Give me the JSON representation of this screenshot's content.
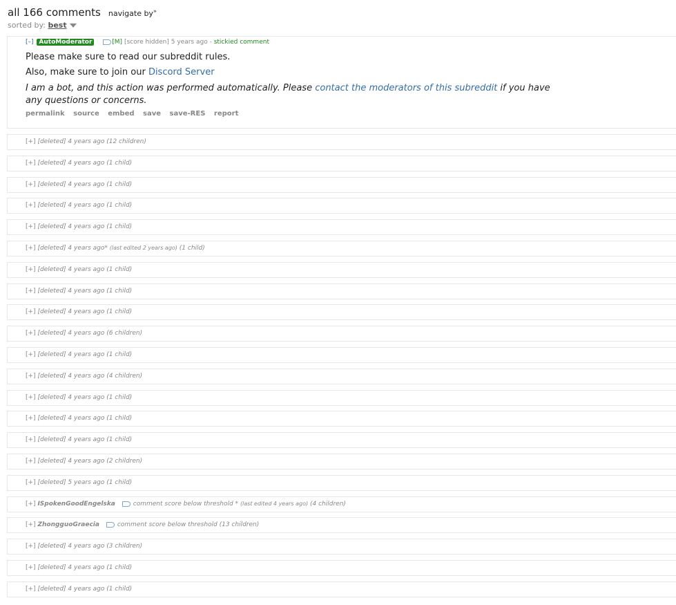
{
  "header": {
    "title": "all 166 comments",
    "navigate": "navigate by",
    "nav_arrow": "»",
    "sorted_label": "sorted by:",
    "sort_value": "best"
  },
  "sticky": {
    "expand": "[–]",
    "author": "AutoModerator",
    "mod_tag": "[M]",
    "score": "[score hidden]",
    "time": "5 years ago",
    "sep": "-",
    "stickied": "stickied comment",
    "line1": "Please make sure to read our subreddit rules.",
    "line2_prefix": "Also, make sure to join our ",
    "line2_link": "Discord Server",
    "line3_prefix": "I am a bot, and this action was performed automatically. Please ",
    "line3_link": "contact the moderators of this subreddit",
    "line3_suffix": " if you have any questions or concerns.",
    "buttons": [
      "permalink",
      "source",
      "embed",
      "save",
      "save-RES",
      "report"
    ]
  },
  "rows": [
    {
      "text": "[deleted] 4 years ago (12 children)"
    },
    {
      "text": "[deleted] 4 years ago (1 child)"
    },
    {
      "text": "[deleted] 4 years ago (1 child)"
    },
    {
      "text": "[deleted] 4 years ago (1 child)"
    },
    {
      "text": "[deleted] 4 years ago (1 child)"
    },
    {
      "text": "[deleted] 4 years ago*",
      "edit": "(last edited 2 years ago)",
      "tail": "(1 child)"
    },
    {
      "text": "[deleted] 4 years ago (1 child)"
    },
    {
      "text": "[deleted] 4 years ago (1 child)"
    },
    {
      "text": "[deleted] 4 years ago (1 child)"
    },
    {
      "text": "[deleted] 4 years ago (6 children)"
    },
    {
      "text": "[deleted] 4 years ago (1 child)"
    },
    {
      "text": "[deleted] 4 years ago (4 children)"
    },
    {
      "text": "[deleted] 4 years ago (1 child)"
    },
    {
      "text": "[deleted] 4 years ago (1 child)"
    },
    {
      "text": "[deleted] 4 years ago (1 child)"
    },
    {
      "text": "[deleted] 4 years ago (2 children)"
    },
    {
      "text": "[deleted] 5 years ago (1 child)"
    },
    {
      "author": "ISpokenGoodEngelska",
      "text": "comment score below threshold *",
      "edit": "(last edited 4 years ago)",
      "tail": "(4 children)"
    },
    {
      "author": "ZhongguoGraecia",
      "text": "comment score below threshold  (13 children)"
    },
    {
      "text": "[deleted] 4 years ago (3 children)"
    },
    {
      "text": "[deleted] 4 years ago (1 child)"
    },
    {
      "text": "[deleted] 4 years ago (1 child)"
    }
  ],
  "row_expand": "[+]"
}
